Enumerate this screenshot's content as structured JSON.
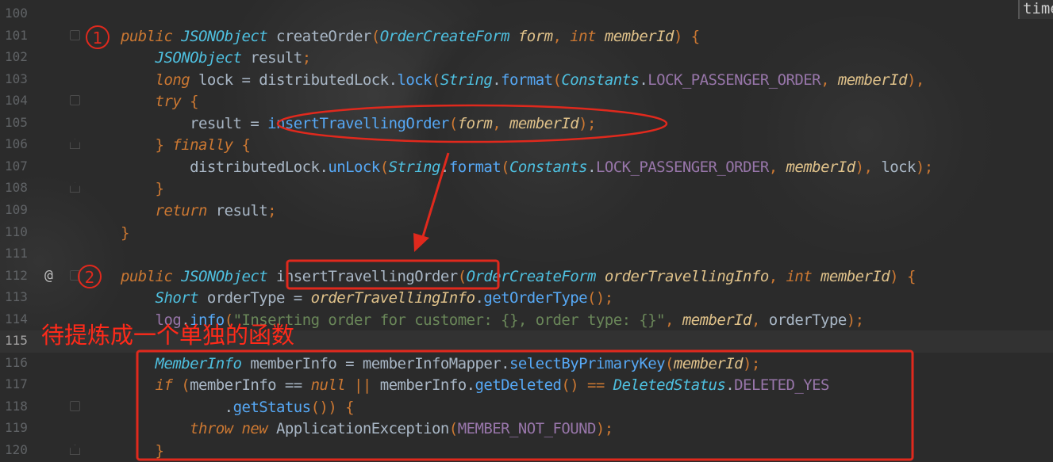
{
  "editor": {
    "lines": [
      {
        "num": "100",
        "tokens": []
      },
      {
        "num": "101",
        "tokens": [
          [
            "kw",
            "public "
          ],
          [
            "ty2",
            "JSONObject "
          ],
          [
            "fn",
            "createOrder"
          ],
          [
            "pu",
            "("
          ],
          [
            "ty2",
            "OrderCreateForm "
          ],
          [
            "pa",
            "form"
          ],
          [
            "pu",
            ", "
          ],
          [
            "kw",
            "int "
          ],
          [
            "pa",
            "memberId"
          ],
          [
            "pu",
            ") {"
          ]
        ]
      },
      {
        "num": "102",
        "tokens": [
          [
            "ty2",
            "    JSONObject "
          ],
          [
            "fn",
            "result"
          ],
          [
            "pu",
            ";"
          ]
        ]
      },
      {
        "num": "103",
        "tokens": [
          [
            "kw",
            "    long "
          ],
          [
            "fn",
            "lock = distributedLock."
          ],
          [
            "mc",
            "lock"
          ],
          [
            "pu",
            "("
          ],
          [
            "ty2",
            "String"
          ],
          [
            "fn",
            "."
          ],
          [
            "mc",
            "format"
          ],
          [
            "pu",
            "("
          ],
          [
            "ty2",
            "Constants"
          ],
          [
            "fn",
            "."
          ],
          [
            "st",
            "LOCK_PASSENGER_ORDER"
          ],
          [
            "pu",
            ", "
          ],
          [
            "pa",
            "memberId"
          ],
          [
            "pu",
            "), "
          ]
        ]
      },
      {
        "num": "104",
        "tokens": [
          [
            "kw",
            "    try "
          ],
          [
            "pu",
            "{"
          ]
        ]
      },
      {
        "num": "105",
        "tokens": [
          [
            "fn",
            "        result = "
          ],
          [
            "mc",
            "insertTravellingOrder"
          ],
          [
            "pu",
            "("
          ],
          [
            "pa",
            "form"
          ],
          [
            "pu",
            ", "
          ],
          [
            "pa",
            "memberId"
          ],
          [
            "pu",
            ");"
          ]
        ]
      },
      {
        "num": "106",
        "tokens": [
          [
            "pu",
            "    } "
          ],
          [
            "kw",
            "finally "
          ],
          [
            "pu",
            "{"
          ]
        ]
      },
      {
        "num": "107",
        "tokens": [
          [
            "fn",
            "        distributedLock."
          ],
          [
            "mc",
            "unLock"
          ],
          [
            "pu",
            "("
          ],
          [
            "ty2",
            "String"
          ],
          [
            "fn",
            "."
          ],
          [
            "mc",
            "format"
          ],
          [
            "pu",
            "("
          ],
          [
            "ty2",
            "Constants"
          ],
          [
            "fn",
            "."
          ],
          [
            "st",
            "LOCK_PASSENGER_ORDER"
          ],
          [
            "pu",
            ", "
          ],
          [
            "pa",
            "memberId"
          ],
          [
            "pu",
            "), "
          ],
          [
            "fn",
            "lock"
          ],
          [
            "pu",
            ");"
          ]
        ]
      },
      {
        "num": "108",
        "tokens": [
          [
            "pu",
            "    }"
          ]
        ]
      },
      {
        "num": "109",
        "tokens": [
          [
            "kw",
            "    return "
          ],
          [
            "fn",
            "result"
          ],
          [
            "pu",
            ";"
          ]
        ]
      },
      {
        "num": "110",
        "tokens": [
          [
            "pu",
            "}"
          ]
        ]
      },
      {
        "num": "111",
        "tokens": []
      },
      {
        "num": "112",
        "tokens": [
          [
            "kw",
            "public "
          ],
          [
            "ty2",
            "JSONObject "
          ],
          [
            "fn",
            "insertTravellingOrder"
          ],
          [
            "pu",
            "("
          ],
          [
            "ty2",
            "OrderCreateForm "
          ],
          [
            "pa",
            "orderTravellingInfo"
          ],
          [
            "pu",
            ", "
          ],
          [
            "kw",
            "int "
          ],
          [
            "pa",
            "memberId"
          ],
          [
            "pu",
            ") {"
          ]
        ]
      },
      {
        "num": "113",
        "tokens": [
          [
            "ty2",
            "    Short "
          ],
          [
            "fn",
            "orderType = "
          ],
          [
            "pa",
            "orderTravellingInfo"
          ],
          [
            "fn",
            "."
          ],
          [
            "mc",
            "getOrderType"
          ],
          [
            "pu",
            "();"
          ]
        ]
      },
      {
        "num": "114",
        "tokens": [
          [
            "st",
            "    log"
          ],
          [
            "fn",
            "."
          ],
          [
            "mc",
            "info"
          ],
          [
            "pu",
            "("
          ],
          [
            "str",
            "\"Inserting order for customer: {}, order type: {}\""
          ],
          [
            "pu",
            ", "
          ],
          [
            "pa",
            "memberId"
          ],
          [
            "pu",
            ", "
          ],
          [
            "fn",
            "orderType"
          ],
          [
            "pu",
            ");"
          ]
        ]
      },
      {
        "num": "115",
        "tokens": []
      },
      {
        "num": "116",
        "tokens": [
          [
            "ty2",
            "    MemberInfo "
          ],
          [
            "fn",
            "memberInfo = memberInfoMapper."
          ],
          [
            "mc",
            "selectByPrimaryKey"
          ],
          [
            "pu",
            "("
          ],
          [
            "pa",
            "memberId"
          ],
          [
            "pu",
            ");"
          ]
        ]
      },
      {
        "num": "117",
        "tokens": [
          [
            "kw",
            "    if "
          ],
          [
            "pu",
            "("
          ],
          [
            "fn",
            "memberInfo == "
          ],
          [
            "kw",
            "null "
          ],
          [
            "pu",
            "|| "
          ],
          [
            "fn",
            "memberInfo."
          ],
          [
            "mc",
            "getDeleted"
          ],
          [
            "pu",
            "() == "
          ],
          [
            "ty2",
            "DeletedStatus"
          ],
          [
            "fn",
            "."
          ],
          [
            "st",
            "DELETED_YES"
          ]
        ]
      },
      {
        "num": "118",
        "tokens": [
          [
            "fn",
            "            ."
          ],
          [
            "mc",
            "getStatus"
          ],
          [
            "pu",
            "()) {"
          ]
        ]
      },
      {
        "num": "119",
        "tokens": [
          [
            "kw",
            "        throw new "
          ],
          [
            "fn",
            "ApplicationException"
          ],
          [
            "pu",
            "("
          ],
          [
            "st",
            "MEMBER_NOT_FOUND"
          ],
          [
            "pu",
            ");"
          ]
        ]
      },
      {
        "num": "120",
        "tokens": [
          [
            "pu",
            "    }"
          ]
        ]
      }
    ],
    "overflow_hint": "time",
    "annotation_bookmark": "@"
  },
  "annotations": {
    "marker_1": "1",
    "marker_2": "2",
    "note": "待提炼成一个单独的函数"
  },
  "colors": {
    "background": "#2b2b2b",
    "keyword": "#cc7832",
    "type": "#4ec0e0",
    "method": "#56a8f5",
    "param": "#e0c28a",
    "annotation": "#e0291d"
  }
}
